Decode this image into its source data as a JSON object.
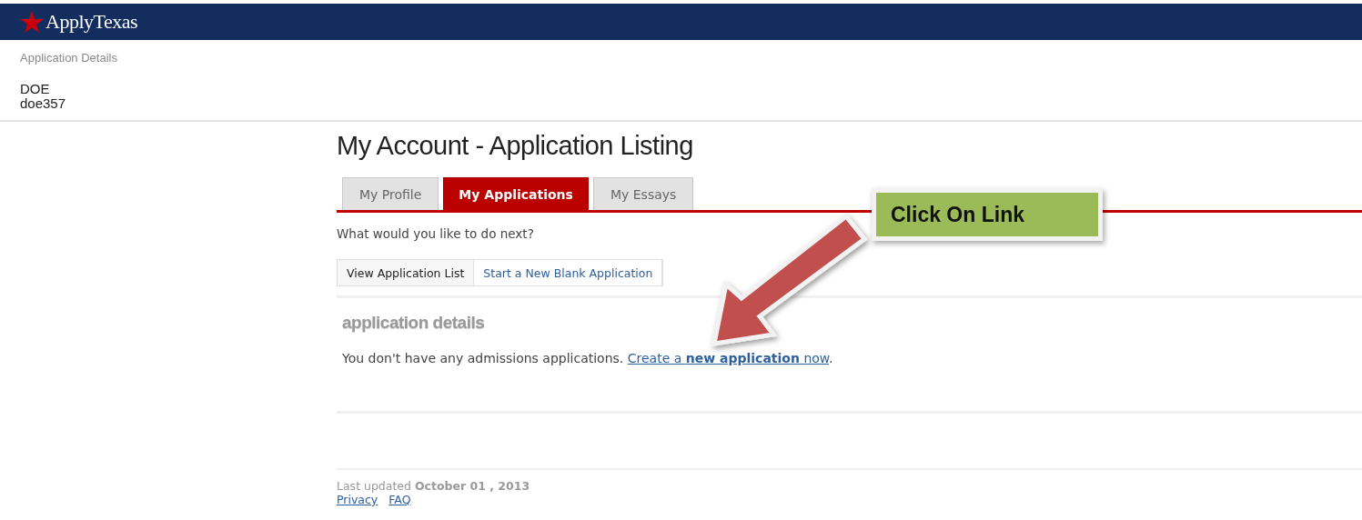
{
  "header": {
    "logo": "ApplyTexas"
  },
  "subheader": {
    "title": "Application Details",
    "user_lines": [
      "DOE",
      "doe357"
    ]
  },
  "page_title": "My Account - Application Listing",
  "tabs": [
    {
      "label": "My Profile",
      "selected": false
    },
    {
      "label": "My Applications",
      "selected": true
    },
    {
      "label": "My Essays",
      "selected": false
    }
  ],
  "prompt": "What would you like to do next?",
  "subtabs": [
    {
      "label": "View Application List",
      "selected": true
    },
    {
      "label": "Start a New Blank Application",
      "selected": false
    }
  ],
  "section": {
    "heading": "application details",
    "message": "You don't have any admissions applications.",
    "link": "Create a **new application** now",
    "end": "."
  },
  "footer": {
    "updated": "Last updated **October 01 , 2013**",
    "links": [
      "Privacy",
      "FAQ"
    ]
  },
  "callout": {
    "text": "Click On Link"
  }
}
